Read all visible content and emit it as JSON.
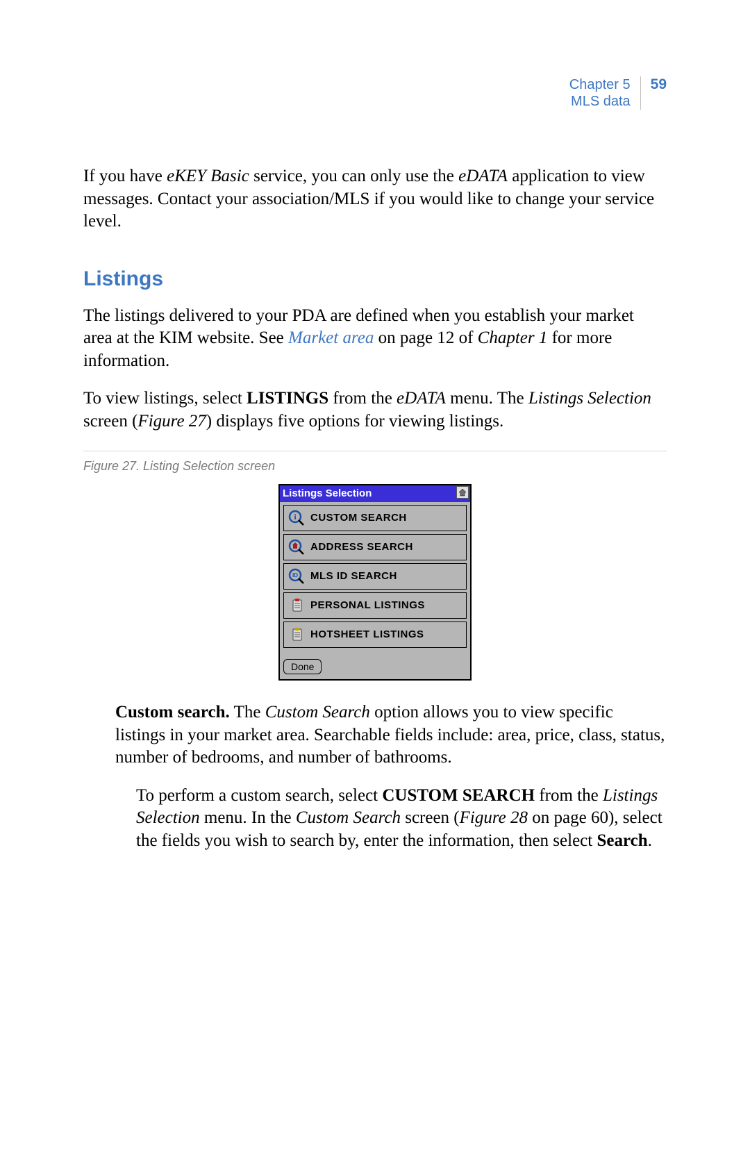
{
  "header": {
    "chapter_line": "Chapter 5",
    "section_line": "MLS data",
    "page_number": "59"
  },
  "intro": {
    "p1_prefix": "If you have ",
    "p1_em1": "eKEY Basic",
    "p1_mid1": " service, you can only use the ",
    "p1_em2": "eDATA",
    "p1_suffix": " application to view messages.  Contact your association/MLS if you would like to change your service level."
  },
  "listings": {
    "heading": "Listings",
    "p1_a": "The listings delivered to your PDA are defined when you establish your market area at the KIM website.  See ",
    "p1_link": "Market area",
    "p1_b": " on page 12 of ",
    "p1_em": "Chapter 1",
    "p1_c": " for more information.",
    "p2_a": "To view listings, select ",
    "p2_b": "LISTINGS",
    "p2_c": " from the ",
    "p2_em": "eDATA",
    "p2_d": " menu.  The ",
    "p2_em2": "Listings Selection",
    "p2_e": " screen (",
    "p2_em3": "Figure 27",
    "p2_f": ") displays five options for viewing listings."
  },
  "figure": {
    "caption": "Figure 27.  Listing Selection screen",
    "pda_title": "Listings Selection",
    "items": [
      {
        "label": "CUSTOM SEARCH",
        "icon": "info"
      },
      {
        "label": "ADDRESS SEARCH",
        "icon": "house"
      },
      {
        "label": "MLS ID SEARCH",
        "icon": "id"
      },
      {
        "label": "PERSONAL LISTINGS",
        "icon": "clip-red"
      },
      {
        "label": "HOTSHEET LISTINGS",
        "icon": "clip-gold"
      }
    ],
    "done": "Done"
  },
  "custom_search": {
    "term": "Custom search.",
    "p1_a": "  The ",
    "p1_em1": "Custom Search",
    "p1_b": " option allows you to view specific listings in your market area.  Searchable fields include: area, price, class, status, number of bedrooms, and number of bathrooms.",
    "p2_a": "To perform a custom search, select ",
    "p2_b": "CUSTOM SEARCH",
    "p2_c": " from the ",
    "p2_em1": "Listings Selection",
    "p2_d": " menu.  In the ",
    "p2_em2": "Custom Search",
    "p2_e": " screen (",
    "p2_em3": "Figure 28",
    "p2_f": " on page 60), select the fields you wish to search by, enter the information, then select ",
    "p2_g": "Search",
    "p2_h": "."
  }
}
